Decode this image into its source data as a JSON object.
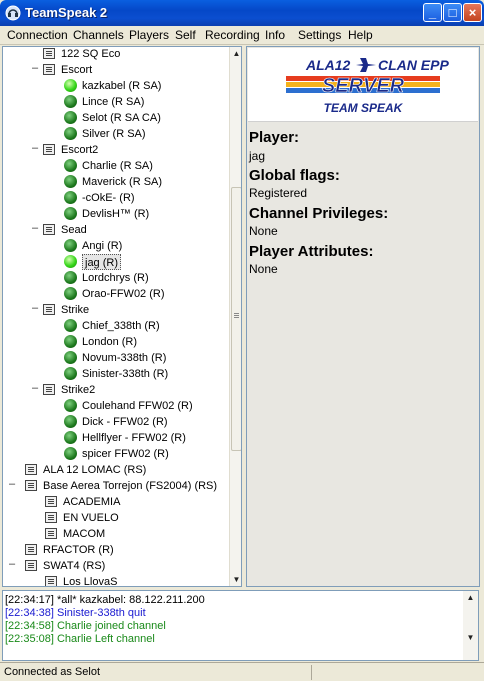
{
  "window": {
    "title": "TeamSpeak 2",
    "app_icon": "headset-icon"
  },
  "menu": [
    "Connection",
    "Channels",
    "Players",
    "Self",
    "Recording",
    "Info",
    "Settings",
    "Help"
  ],
  "tree": {
    "channels": [
      {
        "name": "122 SQ Eco",
        "players": []
      },
      {
        "name": "Escort",
        "players": [
          "kazkabel  (R SA)",
          "Lince  (R SA)",
          "Selot  (R SA CA)",
          "Silver  (R SA)"
        ]
      },
      {
        "name": "Escort2",
        "players": [
          "Charlie  (R SA)",
          "Maverick  (R SA)",
          "-cOkE-  (R)",
          "DevlisH™  (R)"
        ]
      },
      {
        "name": "Sead",
        "players": [
          "Angi  (R)",
          "jag  (R)",
          "Lordchrys  (R)",
          "Orao-FFW02  (R)"
        ]
      },
      {
        "name": "Strike",
        "players": [
          "Chief_338th  (R)",
          "London  (R)",
          "Novum-338th  (R)",
          "Sinister-338th  (R)"
        ]
      },
      {
        "name": "Strike2",
        "players": [
          "Coulehand FFW02  (R)",
          "Dick - FFW02  (R)",
          "Hellflyer - FFW02  (R)",
          "spicer FFW02  (R)"
        ]
      }
    ],
    "top_channels": [
      {
        "name": "ALA 12 LOMAC    (RS)"
      },
      {
        "name": "Base Aerea Torrejon (FS2004)    (RS)",
        "subs": [
          "ACADEMIA",
          "EN VUELO",
          "MACOM"
        ]
      },
      {
        "name": "RFACTOR    (R)"
      },
      {
        "name": "SWAT4    (RS)",
        "subs": [
          "Los LlovaS"
        ]
      }
    ]
  },
  "banner": {
    "line1": "ALA12",
    "line2": "CLAN EPP",
    "line3": "SERVER",
    "line4": "TEAM SPEAK"
  },
  "info": {
    "player_label": "Player:",
    "player_value": "jag",
    "flags_label": "Global flags:",
    "flags_value": "Registered",
    "chanpriv_label": "Channel Privileges:",
    "chanpriv_value": "None",
    "attrs_label": "Player Attributes:",
    "attrs_value": "None"
  },
  "log": [
    {
      "text": "[22:34:17] *all* kazkabel: 88.122.211.200",
      "color": "#000000"
    },
    {
      "text": "[22:34:38] Sinister-338th quit",
      "color": "#1a1ad0"
    },
    {
      "text": "[22:34:58] Charlie joined channel",
      "color": "#1a8a1a"
    },
    {
      "text": "[22:35:08] Charlie Left channel",
      "color": "#1a8a1a"
    }
  ],
  "status": "Connected as Selot"
}
